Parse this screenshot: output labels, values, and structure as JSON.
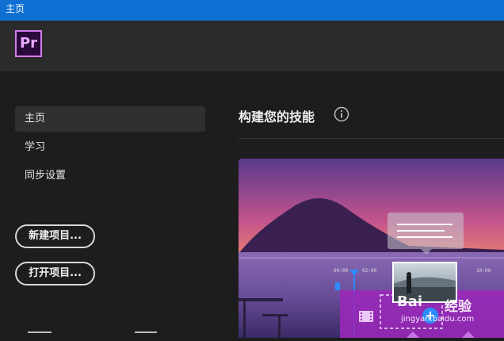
{
  "window": {
    "title": "主页"
  },
  "app": {
    "logo_text": "Pr"
  },
  "sidebar": {
    "items": [
      {
        "label": "主页",
        "active": true
      },
      {
        "label": "学习",
        "active": false
      },
      {
        "label": "同步设置",
        "active": false
      }
    ],
    "buttons": {
      "new_project": "新建项目...",
      "open_project": "打开项目..."
    }
  },
  "main": {
    "heading": "构建您的技能",
    "hero": {
      "timecodes": [
        "00:00",
        "02:00",
        "10:00"
      ],
      "watermark_brand": "Bai",
      "watermark_suffix": "经验",
      "watermark_url": "jingyan.baidu.com"
    }
  },
  "colors": {
    "titlebar": "#0f6fd2",
    "accent": "#d47cf0",
    "timeline": "#9b28b9",
    "playhead": "#2b8bff"
  },
  "icons": {
    "info": "info-icon",
    "film": "film-icon",
    "plus": "plus-icon"
  }
}
